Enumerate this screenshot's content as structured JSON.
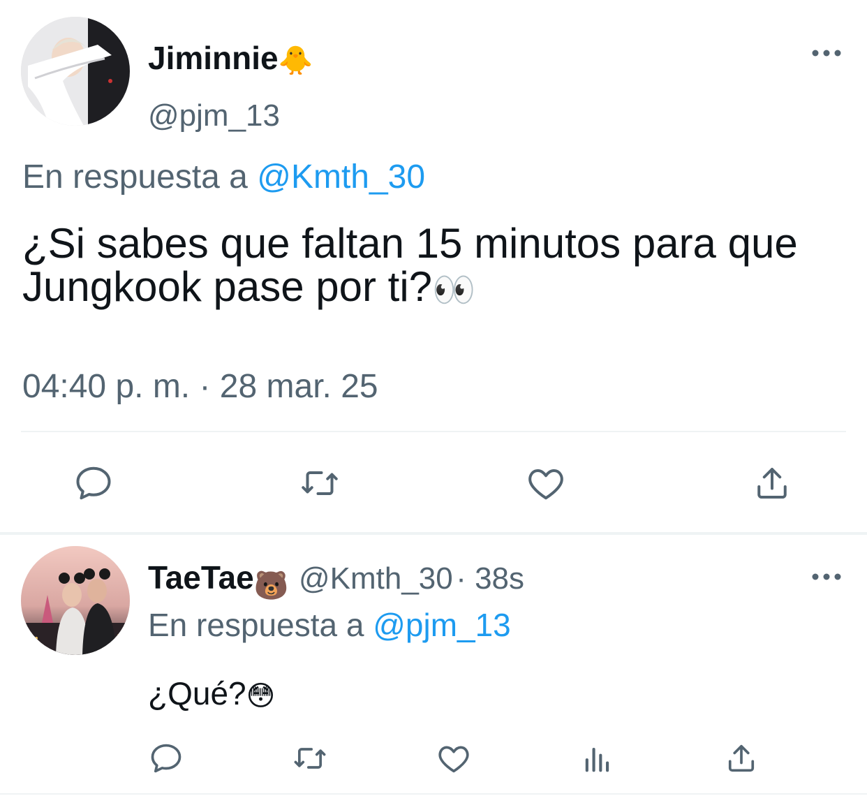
{
  "main_tweet": {
    "author_name": "Jiminnie",
    "author_emoji": "🐥",
    "author_handle": "@pjm_13",
    "reply_prefix": "En respuesta a",
    "reply_to": "@Kmth_30",
    "text": "¿Si sabes que faltan 15 minutos para que Jungkook pase por ti?",
    "text_emoji": "👀",
    "timestamp": "04:40 p. m. · 28 mar. 25",
    "actions": [
      "reply-icon",
      "retweet-icon",
      "like-icon",
      "share-icon"
    ]
  },
  "reply_tweet": {
    "author_name": "TaeTae",
    "author_emoji": "🐻",
    "author_handle": "@Kmth_30",
    "time_ago": "· 38s",
    "reply_prefix": "En respuesta a",
    "reply_to": "@pjm_13",
    "text": "¿Qué?",
    "text_emoji": "😳",
    "actions": [
      "reply-icon",
      "retweet-icon",
      "like-icon",
      "analytics-icon",
      "share-icon"
    ]
  },
  "colors": {
    "text": "#0f1419",
    "muted": "#536471",
    "link": "#1d9bf0",
    "divider": "#eff3f4"
  }
}
